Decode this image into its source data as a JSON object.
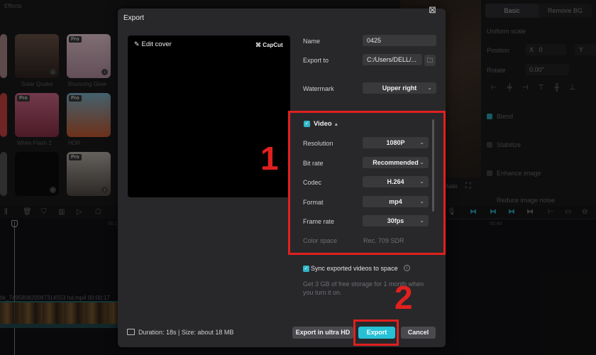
{
  "background": {
    "left_tab": "Effects",
    "effects": [
      {
        "label": "Solar Quake",
        "pro": false
      },
      {
        "label": "Bouncing Glow",
        "pro": true
      },
      {
        "label": "White Flash 2",
        "pro": true
      },
      {
        "label": "HDR",
        "pro": true
      },
      {
        "label": "",
        "pro": false
      },
      {
        "label": "",
        "pro": true
      }
    ],
    "pro_badge": "Pro",
    "right_panel": {
      "tabs": [
        "Basic",
        "Remove BG"
      ],
      "uniform_scale": "Uniform scale",
      "position_label": "Position",
      "x_label": "X",
      "x_value": "0",
      "y_label": "Y",
      "rotate_label": "Rotate",
      "rotate_value": "0.00°",
      "blend": "Blend",
      "stabilize": "Stabilize",
      "enhance_image": "Enhance image",
      "reduce_noise": "Reduce image noise",
      "timecode": "00:40"
    },
    "timeline": {
      "clip_name": "tik_749580820087314553 hd.mp4  00:00:17",
      "ruler_mark": "00:10"
    },
    "preview_ratio": "Ratio"
  },
  "dialog": {
    "title": "Export",
    "cover_edit": "Edit cover",
    "cover_logo": "CapCut",
    "name_label": "Name",
    "name_value": "0425",
    "export_to_label": "Export to",
    "export_to_value": "C:/Users/DELL/...",
    "watermark_label": "Watermark",
    "watermark_value": "Upper right",
    "video_section": "Video",
    "resolution_label": "Resolution",
    "resolution_value": "1080P",
    "bitrate_label": "Bit rate",
    "bitrate_value": "Recommended",
    "codec_label": "Codec",
    "codec_value": "H.264",
    "format_label": "Format",
    "format_value": "mp4",
    "framerate_label": "Frame rate",
    "framerate_value": "30fps",
    "colorspace_label": "Color space",
    "colorspace_value": "Rec. 709 SDR",
    "sync_label": "Sync exported videos to space",
    "storage_text": "Get 3 GB of free storage for 1 month when you turn it on.",
    "duration_text": "Duration: 18s | Size: about 18 MB",
    "export_hd_label": "Export in ultra HD",
    "export_label": "Export",
    "cancel_label": "Cancel"
  },
  "annotations": {
    "step1": "1",
    "step2": "2"
  },
  "colors": {
    "accent": "#27c1d6",
    "annotation_red": "#e0201f",
    "dialog_bg": "#28282b"
  }
}
